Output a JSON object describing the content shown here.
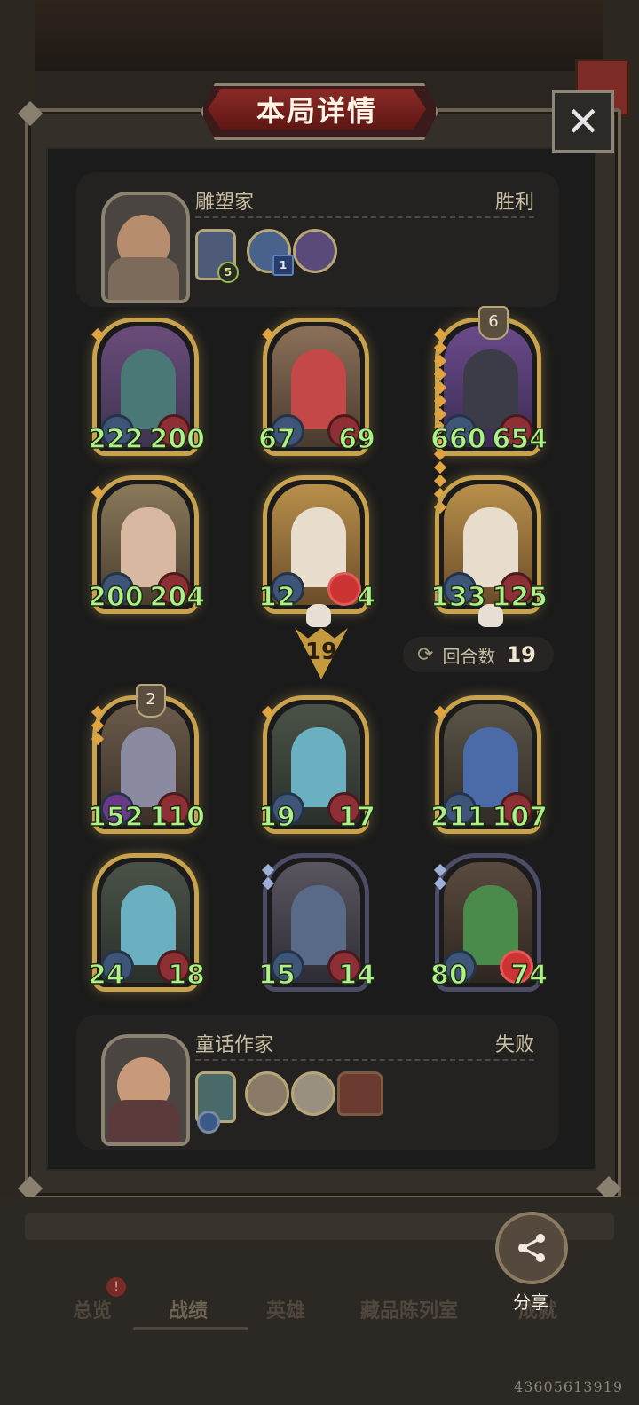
{
  "title": "本局详情",
  "close_label": "✕",
  "top_player": {
    "name": "雕塑家",
    "result": "胜利",
    "hero_badge": "5",
    "item_badge": "1"
  },
  "bottom_player": {
    "name": "童话作家",
    "result": "失败"
  },
  "top_cards": [
    {
      "atk": "222",
      "hp": "200",
      "level": ""
    },
    {
      "atk": "67",
      "hp": "69",
      "level": ""
    },
    {
      "atk": "660",
      "hp": "654",
      "level": "6"
    },
    {
      "atk": "200",
      "hp": "204",
      "level": ""
    },
    {
      "atk": "12",
      "hp": "4",
      "level": ""
    },
    {
      "atk": "133",
      "hp": "125",
      "level": ""
    }
  ],
  "bottom_cards": [
    {
      "atk": "152",
      "hp": "110",
      "level": "2"
    },
    {
      "atk": "19",
      "hp": "17",
      "level": ""
    },
    {
      "atk": "211",
      "hp": "107",
      "level": ""
    },
    {
      "atk": "24",
      "hp": "18",
      "level": ""
    },
    {
      "atk": "15",
      "hp": "14",
      "level": ""
    },
    {
      "atk": "80",
      "hp": "74",
      "level": ""
    }
  ],
  "attack_marker": "19",
  "round": {
    "label": "回合数",
    "value": "19"
  },
  "nav": [
    "总览",
    "战绩",
    "英雄",
    "藏品陈列室",
    "成就"
  ],
  "share_label": "分享",
  "uid": "43605613919",
  "colors": {
    "gold_frame": "#c9a24e",
    "stat_green": "#aef08a",
    "title_red": "#8a2b27"
  }
}
